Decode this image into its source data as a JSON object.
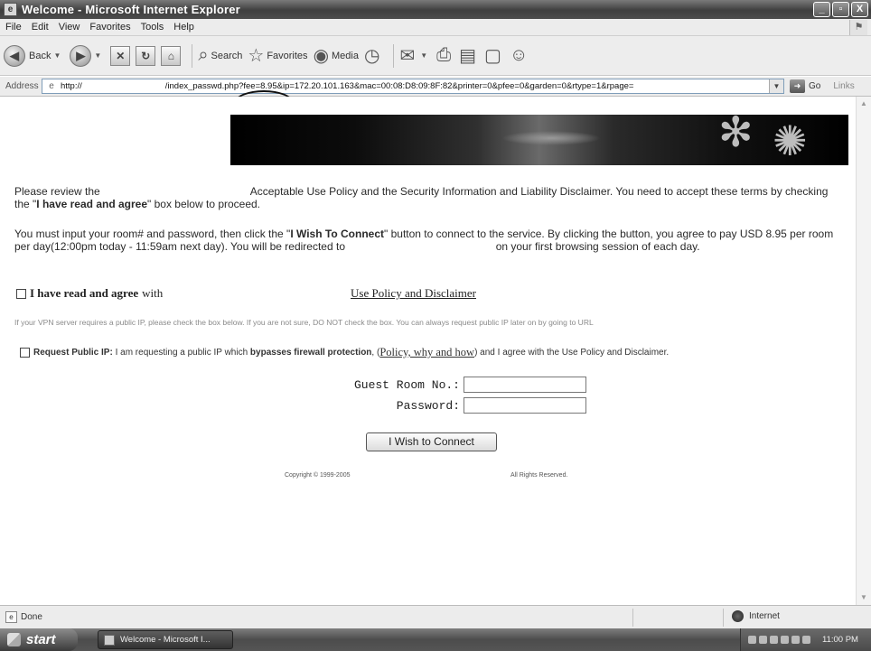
{
  "window": {
    "title": "Welcome - Microsoft Internet Explorer",
    "controls": {
      "minimize": "_",
      "maximize": "▫",
      "close": "X"
    }
  },
  "menubar": {
    "items": [
      "File",
      "Edit",
      "View",
      "Favorites",
      "Tools",
      "Help"
    ]
  },
  "toolbar": {
    "back_label": "Back",
    "search_label": "Search",
    "favorites_label": "Favorites",
    "media_label": "Media"
  },
  "addressbar": {
    "label": "Address",
    "url_prefix": "http://",
    "url_path": "/index_passwd.php?fee=8.95&ip=172.20.101.163&mac=00:08:D8:09:8F:82&printer=0&pfee=0&garden=0&rtype=1&rpage=",
    "go_label": "Go",
    "links_label": "Links"
  },
  "page": {
    "para1_a": "Please review the",
    "para1_b": "Acceptable Use Policy and the Security Information and Liability Disclaimer. You need to accept these terms by checking the \"",
    "para1_bold": "I have read and agree",
    "para1_c": "\" box below to proceed.",
    "para2_a": "You must input your room# and password, then click the \"",
    "para2_bold": "I Wish To Connect",
    "para2_b": "\" button to connect to the service. By clicking the button, you agree to pay USD 8.95 per room per day(12:00pm today - 11:59am next day). You will be redirected to",
    "para2_c": "on your first browsing session of each day.",
    "agree_label": "I have read and agree",
    "agree_with": "with",
    "policy_link": "Use Policy and Disclaimer",
    "vpn_note": "If your VPN server requires a public IP, please check the box below. If you are not sure, DO NOT check the box. You can always request public IP later on by going to URL",
    "pubip_label": "Request Public IP:",
    "pubip_text_a": "I am requesting a public IP which",
    "pubip_bold": "bypasses firewall protection",
    "pubip_link": "Policy, why and how",
    "pubip_text_b": "and I agree with the Use Policy and Disclaimer.",
    "room_label": "Guest Room No.:",
    "password_label": "Password:",
    "connect_button": "I Wish to Connect",
    "copyright": "Copyright © 1999-2005",
    "rights": "All Rights Reserved."
  },
  "statusbar": {
    "status": "Done",
    "zone": "Internet"
  },
  "taskbar": {
    "start_label": "start",
    "task_label": "Welcome - Microsoft I...",
    "clock": "11:00 PM"
  }
}
